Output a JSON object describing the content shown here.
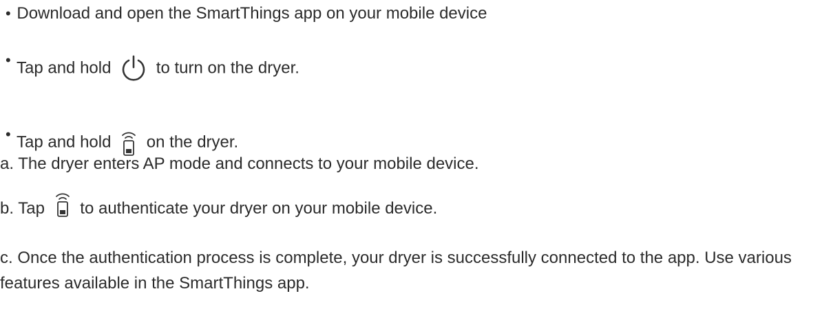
{
  "bullets": [
    {
      "text": "Download and open the SmartThings app on your mobile device"
    },
    {
      "before": "Tap and hold",
      "icon": "power-icon",
      "after": "to turn on the dryer."
    },
    {
      "before": "Tap and hold",
      "icon": "remote-smart-control-icon",
      "after": "on the dryer."
    }
  ],
  "steps": {
    "a": "a. The dryer enters AP mode and connects to your mobile device.",
    "b_before": "b. Tap",
    "b_icon": "remote-smart-control-icon",
    "b_after": "to authenticate your dryer on your mobile device.",
    "c": "c. Once the authentication process is complete, your dryer is successfully connected to the app. Use various features available in the SmartThings app."
  },
  "colors": {
    "text": "#2b2b2b",
    "icon": "#333333"
  }
}
